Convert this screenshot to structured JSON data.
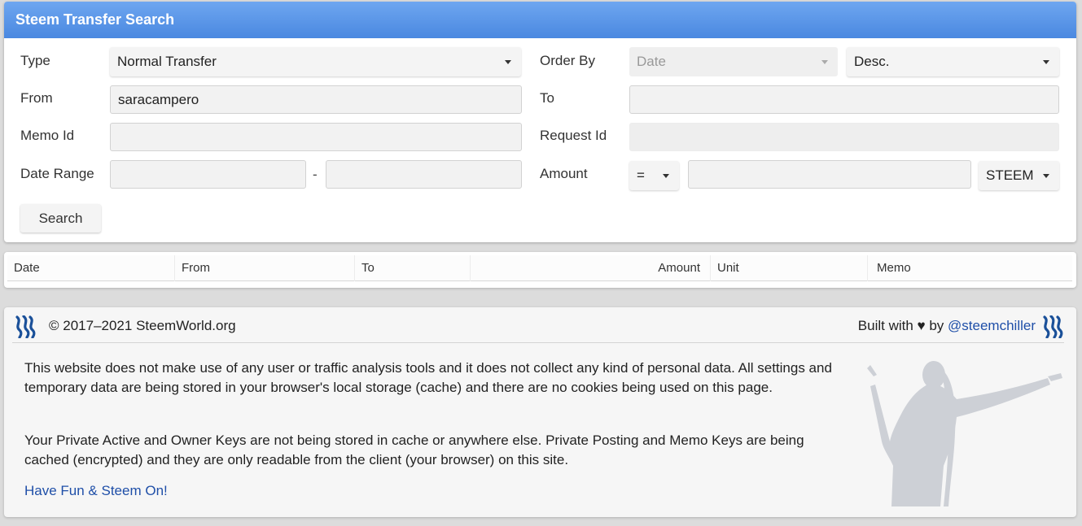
{
  "panel": {
    "title": "Steem Transfer Search",
    "labels": {
      "type": "Type",
      "from": "From",
      "memo_id": "Memo Id",
      "date_range": "Date Range",
      "order_by": "Order By",
      "to": "To",
      "request_id": "Request Id",
      "amount": "Amount"
    },
    "type_select": "Normal Transfer",
    "order_by_select": "Date",
    "order_dir_select": "Desc.",
    "from_value": "saracampero",
    "to_value": "",
    "memo_id_value": "",
    "request_id_value": "",
    "date_from_value": "",
    "date_to_value": "",
    "date_separator": "-",
    "amount_op_select": "=",
    "amount_value": "",
    "unit_select": "STEEM",
    "search_button": "Search"
  },
  "results": {
    "columns": [
      "Date",
      "From",
      "To",
      "Amount",
      "Unit",
      "Memo"
    ]
  },
  "footer": {
    "copyright": "© 2017–2021 SteemWorld.org",
    "built_with": "Built with ♥ by",
    "author_link": "@steemchiller",
    "paragraph1": "This website does not make use of any user or traffic analysis tools and it does not collect any kind of personal data. All settings and temporary data are being stored in your browser's local storage (cache) and there are no cookies being used on this page.",
    "paragraph2": "Your Private Active and Owner Keys are not being stored in cache or anywhere else. Private Posting and Memo Keys are being cached (encrypted) and they are only readable from the client (your browser) on this site.",
    "have_fun": "Have Fun & Steem On!"
  },
  "colors": {
    "header_blue": "#4a88e0",
    "link_blue": "#1f4fa8",
    "logo_blue": "#1a5099"
  },
  "icons": [
    "steem-logo-icon",
    "chevron-down-icon",
    "silhouette-image"
  ]
}
